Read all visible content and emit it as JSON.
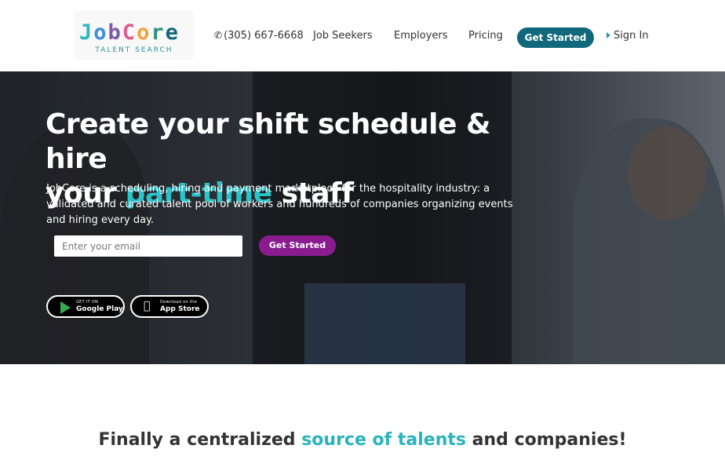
{
  "brand": {
    "logo_text": "JobCore",
    "logo_letters": [
      "J",
      "o",
      "b",
      "C",
      "o",
      "r",
      "e"
    ],
    "logo_colors": [
      "#2bb6bf",
      "#3a8fd6",
      "#7d5aa6",
      "#e15b8a",
      "#f2a33a",
      "#2f8f82",
      "#11687a"
    ],
    "tagline": "TALENT SEARCH"
  },
  "nav": {
    "phone": "(305) 667-6668",
    "job_seekers": "Job Seekers",
    "employers": "Employers",
    "pricing": "Pricing",
    "get_started": "Get Started",
    "sign_in": "Sign In"
  },
  "hero": {
    "title_line1": "Create your shift schedule & hire",
    "title_prefix": "your ",
    "title_accent": "part-time",
    "title_suffix": " staff",
    "subtitle": "JobCore is a scheduling, hiring and payment marketplace for the hospitality industry: a validated and curated talent pool of workers and hundreds of companies organizing events and hiring every day.",
    "email_placeholder": "Enter your email",
    "cta_label": "Get Started"
  },
  "apps": {
    "google_small": "GET IT ON",
    "google_big": "Google Play",
    "apple_small": "Download on the",
    "apple_big": "App Store"
  },
  "section": {
    "heading_prefix": "Finally a centralized ",
    "heading_accent": "source of talents",
    "heading_suffix": " and companies!"
  },
  "colors": {
    "accent_teal": "#2bc3c8",
    "nav_button": "#11687a",
    "hero_button": "#8a1c8f"
  },
  "icons": {
    "phone": "phone-icon",
    "sign_in": "caret-right-icon",
    "google_play": "google-play-icon",
    "apple": "apple-icon"
  }
}
